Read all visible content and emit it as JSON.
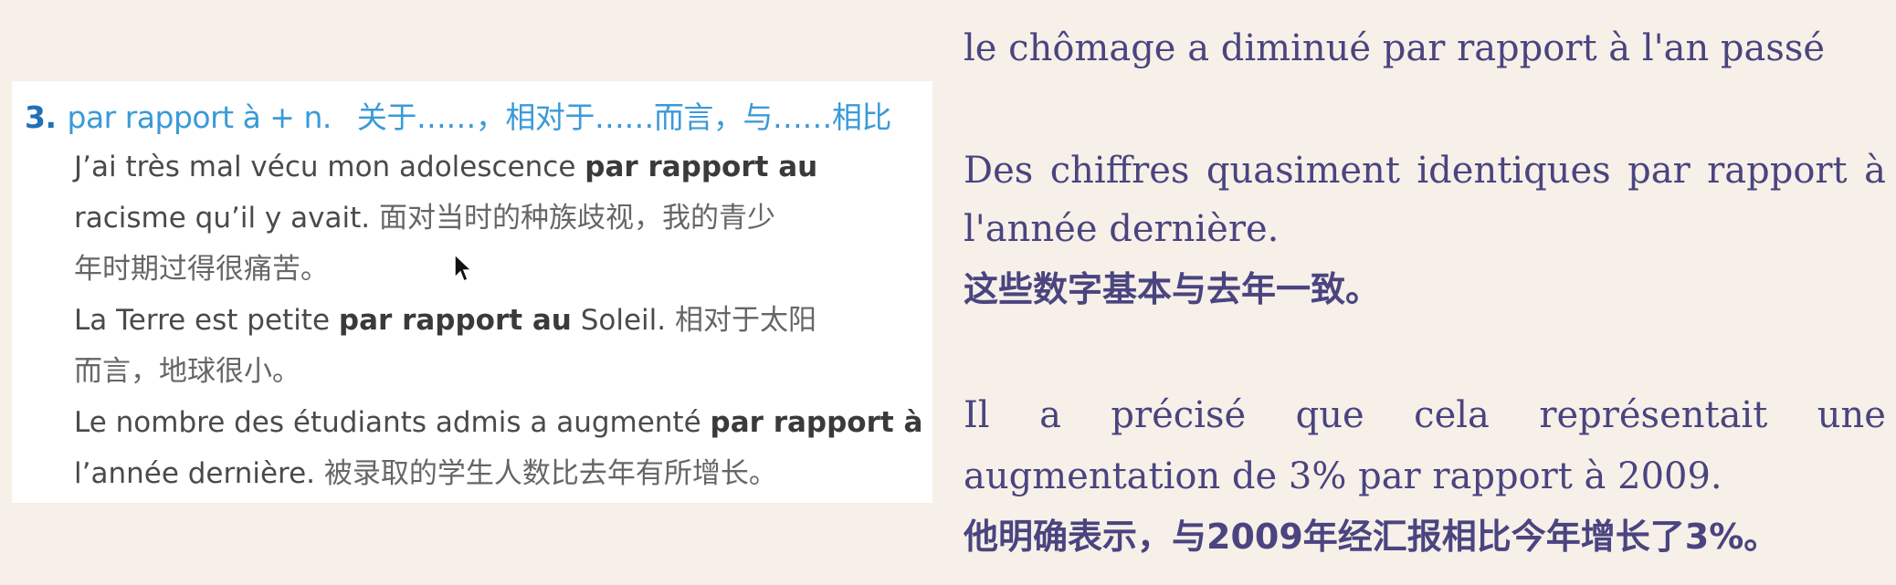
{
  "left": {
    "heading": {
      "number": "3.",
      "phrase": "par rapport à + n.",
      "chinese": "关于……，相对于……而言，与……相比"
    },
    "lines": [
      {
        "parts": [
          {
            "t": "J’ai très mal vécu mon adolescence ",
            "b": false
          },
          {
            "t": "par rapport au",
            "b": true
          }
        ]
      },
      {
        "parts": [
          {
            "t": "racisme qu’il y avait.   ",
            "b": false
          },
          {
            "t": "面对当时的种族歧视，我的青少",
            "b": false,
            "cn": true
          }
        ]
      },
      {
        "parts": [
          {
            "t": "年时期过得很痛苦。",
            "b": false,
            "cn": true
          }
        ]
      },
      {
        "parts": [
          {
            "t": "La Terre est petite ",
            "b": false
          },
          {
            "t": "par rapport au",
            "b": true
          },
          {
            "t": " Soleil.   ",
            "b": false
          },
          {
            "t": "相对于太阳",
            "b": false,
            "cn": true
          }
        ]
      },
      {
        "parts": [
          {
            "t": "而言，地球很小。",
            "b": false,
            "cn": true
          }
        ]
      },
      {
        "parts": [
          {
            "t": "Le nombre des étudiants admis a augmenté ",
            "b": false
          },
          {
            "t": "par rapport à",
            "b": true
          }
        ]
      },
      {
        "parts": [
          {
            "t": "l’année dernière.   ",
            "b": false
          },
          {
            "t": "被录取的学生人数比去年有所增长。",
            "b": false,
            "cn": true
          }
        ]
      }
    ]
  },
  "right": {
    "line1": "le chômage a diminué par rapport à l'an passé",
    "p2_line1": "Des chiffres quasiment identiques par rapport à",
    "p2_line2": "l'année dernière.",
    "p2_cn": "这些数字基本与去年一致。",
    "p3_line1": "Il a précisé que cela représentait une",
    "p3_line2": "augmentation de 3% par rapport à 2009.",
    "p3_cn": "他明确表示，与2009年经汇报相比今年增长了3%。"
  },
  "colors": {
    "background": "#f6f0e8",
    "card": "#ffffff",
    "heading_blue": "#3a9ad8",
    "number_blue": "#1f70b8",
    "right_text": "#4a4480"
  }
}
